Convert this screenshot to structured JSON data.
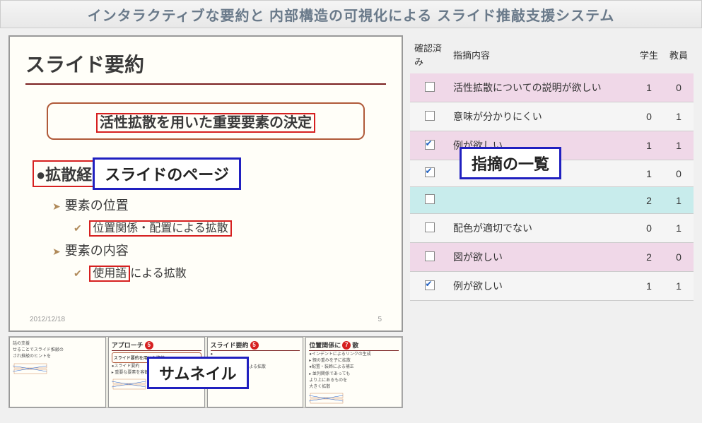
{
  "title": "インタラクティブな要約と 内部構造の可視化による スライド推敲支援システム",
  "slide": {
    "title": "スライド要約",
    "callout": "活性拡散を用いた重要要素の決定",
    "bullet_l1_prefix": "●拡散経",
    "b_l2_a": "要素の位置",
    "b_l3_a": "位置関係・配置による拡散",
    "b_l2_b": "要素の内容",
    "b_l3_b_hl": "使用語",
    "b_l3_b_rest": "による拡散",
    "date": "2012/12/18",
    "page": "5"
  },
  "overlays": {
    "slide_page": "スライドのページ",
    "thumbnail": "サムネイル",
    "indication_list": "指摘の一覧"
  },
  "thumbs": [
    {
      "title": "",
      "circ": "",
      "lines": [
        "話の支援",
        "せることでスライド推敲の",
        "され推敲のヒントを"
      ]
    },
    {
      "title": "アプローチ",
      "circ": "5",
      "box": "スライド要約を用いた推敲",
      "lines": [
        "●スライド要約",
        "▸ 重要な要素を客観的に抽出"
      ]
    },
    {
      "title": "スライド要約",
      "circ": "5",
      "box": "",
      "lines": [
        "●",
        "▸ ",
        "✔ 位置関係・配置による拡散",
        "✔ 使用語による拡散"
      ]
    },
    {
      "title": "位置関係に",
      "circ": "7",
      "title_suffix": "散",
      "lines": [
        "●インデントによるリンクの生成",
        "▸ 親の重みを子に拡散",
        "●配置・装飾による補正",
        "▸ 並列関係であっても",
        "より上にあるものを",
        "大きく拡散"
      ]
    }
  ],
  "table": {
    "headers": {
      "confirmed": "確認済み",
      "content": "指摘内容",
      "student": "学生",
      "teacher": "教員"
    },
    "rows": [
      {
        "checked": false,
        "content": "活性拡散についての説明が欲しい",
        "student": "1",
        "teacher": "0",
        "cls": ""
      },
      {
        "checked": false,
        "content": "意味が分かりにくい",
        "student": "0",
        "teacher": "1",
        "cls": ""
      },
      {
        "checked": true,
        "content": "例が欲しい",
        "student": "1",
        "teacher": "1",
        "cls": ""
      },
      {
        "checked": true,
        "content": "",
        "student": "1",
        "teacher": "0",
        "cls": ""
      },
      {
        "checked": false,
        "content": "",
        "student": "2",
        "teacher": "1",
        "cls": "cyan"
      },
      {
        "checked": false,
        "content": "配色が適切でない",
        "student": "0",
        "teacher": "1",
        "cls": ""
      },
      {
        "checked": false,
        "content": "図が欲しい",
        "student": "2",
        "teacher": "0",
        "cls": ""
      },
      {
        "checked": true,
        "content": "例が欲しい",
        "student": "1",
        "teacher": "1",
        "cls": ""
      }
    ]
  }
}
